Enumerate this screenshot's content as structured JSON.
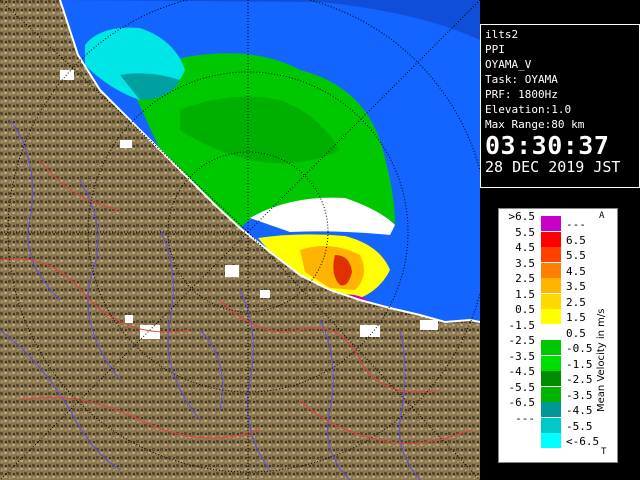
{
  "info": {
    "product": "ilts2",
    "scan": "PPI",
    "site": "OYAMA_V",
    "task": "Task: OYAMA",
    "prf": "PRF: 1800Hz",
    "elevation": "Elevation:1.0",
    "max_range": "Max Range:80 km",
    "time": "03:30:37",
    "date": "28 DEC 2019 JST"
  },
  "legend": {
    "title": "Mean Velocity in m/s",
    "corner_top": "A",
    "corner_bottom": "T",
    "rows": [
      {
        "left": ">6.5",
        "right": "---",
        "color": "#c800c8"
      },
      {
        "left": "5.5",
        "right": "6.5",
        "color": "#ff0000"
      },
      {
        "left": "4.5",
        "right": "5.5",
        "color": "#ff4000"
      },
      {
        "left": "3.5",
        "right": "4.5",
        "color": "#ff8000"
      },
      {
        "left": "2.5",
        "right": "3.5",
        "color": "#ffb400"
      },
      {
        "left": "1.5",
        "right": "2.5",
        "color": "#ffd800"
      },
      {
        "left": "0.5",
        "right": "1.5",
        "color": "#ffff00"
      },
      {
        "left": "-1.5",
        "right": "0.5",
        "color": "#ffffff"
      },
      {
        "left": "-2.5",
        "right": "-0.5",
        "color": "#00c800"
      },
      {
        "left": "-3.5",
        "right": "-1.5",
        "color": "#00e000"
      },
      {
        "left": "-4.5",
        "right": "-2.5",
        "color": "#008c00"
      },
      {
        "left": "-5.5",
        "right": "-3.5",
        "color": "#00b400"
      },
      {
        "left": "-6.5",
        "right": "-4.5",
        "color": "#009696"
      },
      {
        "left": "---",
        "right": "-5.5",
        "color": "#00c8c8"
      },
      {
        "left": "",
        "right": "<-6.5",
        "color": "#00ffff"
      }
    ]
  },
  "map": {
    "sea_color": "#1464ff",
    "land_color": "#8c7850"
  }
}
